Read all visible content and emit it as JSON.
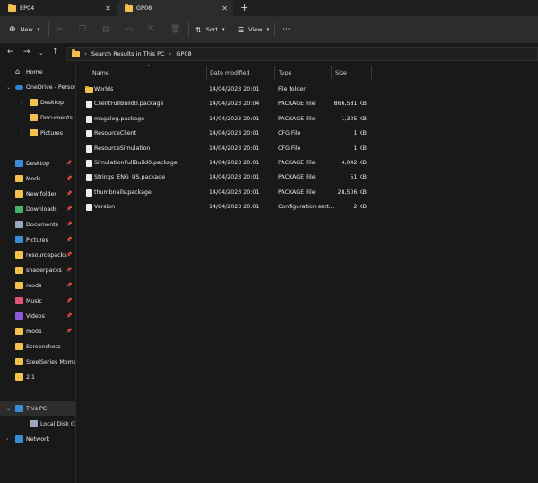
{
  "tabs": [
    {
      "label": "EP04",
      "close": "✕"
    },
    {
      "label": "GP08",
      "close": "✕"
    }
  ],
  "new_tab": "+",
  "toolbar": {
    "new_label": "New",
    "sort_label": "Sort",
    "view_label": "View",
    "more_label": "···"
  },
  "address": {
    "path": [
      "Search Results in This PC",
      "GP08"
    ],
    "sep": "›"
  },
  "sidebar": {
    "items": [
      {
        "label": "Home",
        "icon": "home-icon",
        "color": "#e8e8e8"
      },
      {
        "label": "OneDrive - Persona",
        "icon": "cloud-icon",
        "color": "#2b88d8"
      },
      {
        "label": "Desktop",
        "icon": "folder-icon",
        "color": "#f2c14e"
      },
      {
        "label": "Documents",
        "icon": "folder-icon",
        "color": "#f2c14e"
      },
      {
        "label": "Pictures",
        "icon": "folder-icon",
        "color": "#f2c14e"
      },
      {
        "label": "Desktop",
        "icon": "desktop-icon",
        "color": "#3c8bd9"
      },
      {
        "label": "Mods",
        "icon": "folder-icon",
        "color": "#f2c14e"
      },
      {
        "label": "New folder",
        "icon": "folder-icon",
        "color": "#f2c14e"
      },
      {
        "label": "Downloads",
        "icon": "download-icon",
        "color": "#45b36b"
      },
      {
        "label": "Documents",
        "icon": "documents-icon",
        "color": "#9aa8b8"
      },
      {
        "label": "Pictures",
        "icon": "pictures-icon",
        "color": "#3c8bd9"
      },
      {
        "label": "resourcepacks",
        "icon": "folder-icon",
        "color": "#f2c14e"
      },
      {
        "label": "shaderpacks",
        "icon": "folder-icon",
        "color": "#f2c14e"
      },
      {
        "label": "mods",
        "icon": "folder-icon",
        "color": "#f2c14e"
      },
      {
        "label": "Music",
        "icon": "music-icon",
        "color": "#e0567a"
      },
      {
        "label": "Videos",
        "icon": "videos-icon",
        "color": "#8e5bd8"
      },
      {
        "label": "mod1",
        "icon": "folder-icon",
        "color": "#f2c14e"
      },
      {
        "label": "Screenshots",
        "icon": "folder-icon",
        "color": "#f2c14e"
      },
      {
        "label": "SteelSeries Momen",
        "icon": "folder-icon",
        "color": "#f2c14e"
      },
      {
        "label": "2.1",
        "icon": "folder-icon",
        "color": "#f2c14e"
      },
      {
        "label": "This PC",
        "icon": "pc-icon",
        "color": "#3c8bd9"
      },
      {
        "label": "Local Disk (C:)",
        "icon": "disk-icon",
        "color": "#9aa8b8"
      },
      {
        "label": "Network",
        "icon": "network-icon",
        "color": "#3c8bd9"
      }
    ]
  },
  "columns": {
    "name": "Name",
    "date": "Date modified",
    "type": "Type",
    "size": "Size"
  },
  "files": [
    {
      "name": "Worlds",
      "date": "14/04/2023 20:01",
      "type": "File folder",
      "size": "",
      "kind": "folder"
    },
    {
      "name": "ClientFullBuild0.package",
      "date": "14/04/2023 20:04",
      "type": "PACKAGE File",
      "size": "866,581 KB",
      "kind": "file"
    },
    {
      "name": "magalog.package",
      "date": "14/04/2023 20:01",
      "type": "PACKAGE File",
      "size": "1,325 KB",
      "kind": "file"
    },
    {
      "name": "ResourceClient",
      "date": "14/04/2023 20:01",
      "type": "CFG File",
      "size": "1 KB",
      "kind": "file"
    },
    {
      "name": "ResourceSimulation",
      "date": "14/04/2023 20:01",
      "type": "CFG File",
      "size": "1 KB",
      "kind": "file"
    },
    {
      "name": "SimulationFullBuild0.package",
      "date": "14/04/2023 20:01",
      "type": "PACKAGE File",
      "size": "4,042 KB",
      "kind": "file"
    },
    {
      "name": "Strings_ENG_US.package",
      "date": "14/04/2023 20:01",
      "type": "PACKAGE File",
      "size": "51 KB",
      "kind": "file"
    },
    {
      "name": "thumbnails.package",
      "date": "14/04/2023 20:01",
      "type": "PACKAGE File",
      "size": "28,506 KB",
      "kind": "file"
    },
    {
      "name": "Version",
      "date": "14/04/2023 20:01",
      "type": "Configuration sett...",
      "size": "2 KB",
      "kind": "file"
    }
  ]
}
